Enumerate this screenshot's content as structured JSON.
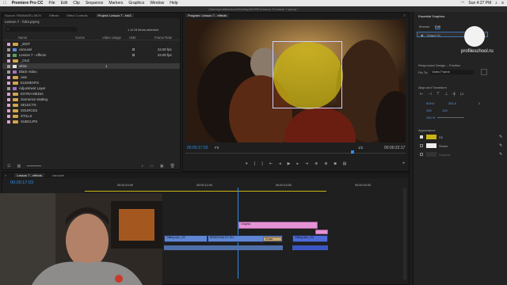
{
  "menubar": {
    "app": "Premiere Pro CC",
    "items": [
      "File",
      "Edit",
      "Clip",
      "Sequence",
      "Markers",
      "Graphics",
      "Window",
      "Help"
    ],
    "time": "Sun 4:27 PM"
  },
  "path": "/Users/profileschool/Desktop/WORK/Lesson 7/Lesson 7.prproj *",
  "project_panel": {
    "tabs": [
      "Source: PANNASEL.MOV",
      "Effects",
      "Effect Controls",
      "Project: Lesson 7 - fxb3"
    ],
    "subtitle": "Lesson 7 - fxb3.prproj",
    "items_selected": "1 of 15 items selected",
    "columns": [
      "Name",
      "Scene",
      "Video Usage",
      "Hide",
      "Frame Rate"
    ],
    "rows": [
      {
        "name": "_EDIT",
        "fps": "",
        "folder": true
      },
      {
        "name": "carousel",
        "fps": "24.00 fps",
        "folder": false,
        "color": "#5a8ad8"
      },
      {
        "name": "Lesson 7 - effects",
        "fps": "24.00 fps",
        "folder": false,
        "color": "#5aa05a"
      },
      {
        "name": "_OLD",
        "fps": "",
        "folder": true
      },
      {
        "name": "white",
        "fps": "",
        "folder": false,
        "color": "#e0e0e0",
        "usage": "1"
      },
      {
        "name": "Black Video",
        "fps": "",
        "folder": false,
        "color": "#a070c0"
      },
      {
        "name": "cats",
        "fps": "",
        "folder": true
      },
      {
        "name": "ELEMENTS",
        "fps": "",
        "folder": true
      },
      {
        "name": "Adjustment Layer",
        "fps": "",
        "folder": false,
        "color": "#a070c0"
      },
      {
        "name": "EXTRA MEDIA",
        "fps": "",
        "folder": true
      },
      {
        "name": "Scenerice skating",
        "fps": "",
        "folder": true
      },
      {
        "name": "SELECTS",
        "fps": "",
        "folder": true
      },
      {
        "name": "SOURCES",
        "fps": "",
        "folder": true
      },
      {
        "name": "STILLS",
        "fps": "",
        "folder": true
      },
      {
        "name": "SUBCLIPS",
        "fps": "",
        "folder": true
      }
    ]
  },
  "program": {
    "title": "Program: Lesson 7 - effects",
    "timecode_left": "00:00:17:03",
    "zoom": "Fit",
    "quality": "1/2",
    "timecode_right": "00:00:22:17"
  },
  "essential_graphics": {
    "title": "Essential Graphics",
    "tabs": [
      "Browse",
      "Edit"
    ],
    "layer": "Shape 01",
    "responsive": "Responsive Design – Position",
    "pin_to_label": "Pin To:",
    "pin_to": "Video Frame",
    "align_header": "Align and Transform",
    "appearance_header": "Appearance",
    "fill_label": "Fill",
    "stroke_label": "Stroke",
    "shadow_label": "Shadow",
    "values": [
      "609.6",
      "351.6",
      "100",
      "100",
      "0",
      "100 %"
    ]
  },
  "timeline": {
    "tabs": [
      "Lesson 7 - effects",
      "carousel"
    ],
    "timecode": "00:00:17:03",
    "ruler": [
      "00:00:10:00",
      "00:00:12:00",
      "00:00:14:00",
      "00:00:16:00"
    ],
    "clips": [
      {
        "label": "Graphic"
      },
      {
        "label": "Gifting Adv_OC"
      },
      {
        "label": "BRIESONA DT 001"
      },
      {
        "label": "Cross Dissolve"
      },
      {
        "label": "Gifting Adv_OC"
      }
    ]
  },
  "watermark": "profileschool.ru",
  "colors": {
    "accent": "#2d8ceb",
    "shape_fill": "#c8b414",
    "graphic_clip": "#e693d5",
    "video_clip": "#5f86d3"
  }
}
